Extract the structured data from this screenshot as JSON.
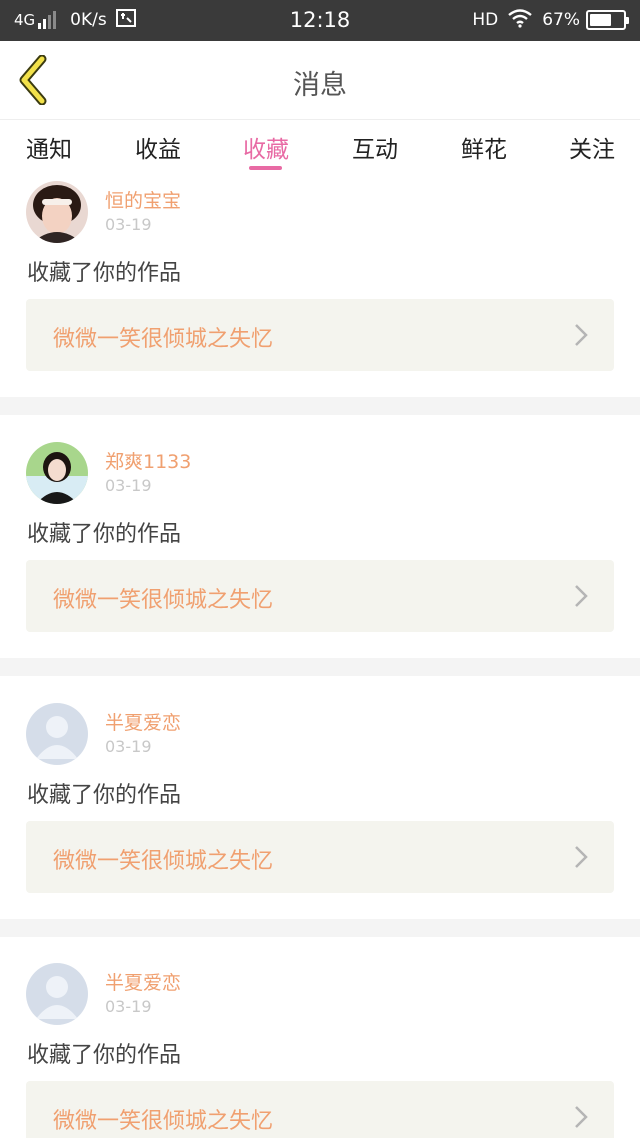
{
  "status_bar": {
    "network": "4G",
    "speed": "0K/s",
    "time": "12:18",
    "hd": "HD",
    "battery_text": "67%",
    "battery_level": 0.67,
    "icons": [
      "signal-icon",
      "screenshot-icon",
      "wifi-icon",
      "battery-icon"
    ]
  },
  "nav": {
    "title": "消息",
    "back_icon": "chevron-left-icon"
  },
  "tabs": [
    {
      "label": "通知"
    },
    {
      "label": "收益"
    },
    {
      "label": "收藏"
    },
    {
      "label": "互动"
    },
    {
      "label": "鲜花"
    },
    {
      "label": "关注"
    }
  ],
  "active_tab": "收藏",
  "colors": {
    "accent": "#e86aa4",
    "username": "#f0a070",
    "work_box_bg": "#f4f4ee",
    "status_bar_bg": "#3a3a3a"
  },
  "messages": [
    {
      "user": "恒的宝宝",
      "date": "03-19",
      "action": "收藏了你的作品",
      "work": "微微一笑很倾城之失忆",
      "avatar": "photo-avatar"
    },
    {
      "user": "郑爽1133",
      "date": "03-19",
      "action": "收藏了你的作品",
      "work": "微微一笑很倾城之失忆",
      "avatar": "photo-avatar"
    },
    {
      "user": "半夏爱恋",
      "date": "03-19",
      "action": "收藏了你的作品",
      "work": "微微一笑很倾城之失忆",
      "avatar": "default-avatar"
    },
    {
      "user": "半夏爱恋",
      "date": "03-19",
      "action": "收藏了你的作品",
      "work": "微微一笑很倾城之失忆",
      "avatar": "default-avatar"
    }
  ]
}
